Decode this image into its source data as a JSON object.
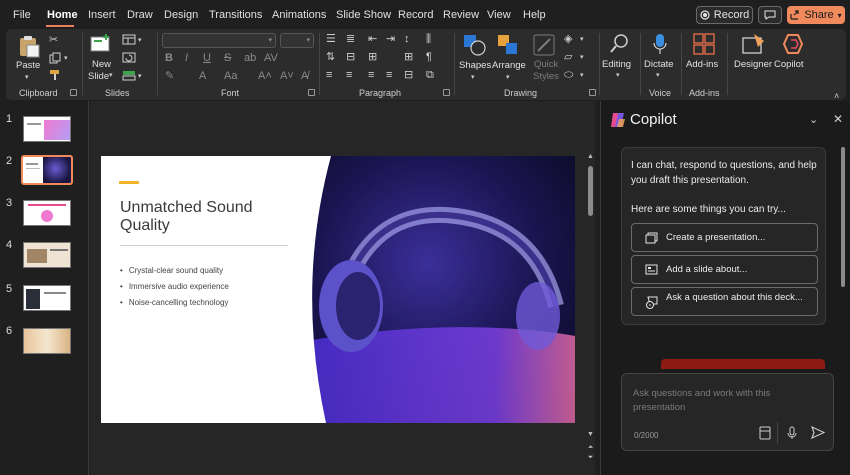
{
  "menu": {
    "items": [
      "File",
      "Home",
      "Insert",
      "Draw",
      "Design",
      "Transitions",
      "Animations",
      "Slide Show",
      "Record",
      "Review",
      "View",
      "Help"
    ],
    "active": "Home",
    "record_label": "Record",
    "share_label": "Share"
  },
  "ribbon": {
    "clipboard": {
      "paste": "Paste",
      "group": "Clipboard"
    },
    "slides": {
      "new_slide_line1": "New",
      "new_slide_line2": "Slide",
      "group": "Slides"
    },
    "font": {
      "group": "Font"
    },
    "paragraph": {
      "group": "Paragraph"
    },
    "drawing": {
      "shapes": "Shapes",
      "arrange": "Arrange",
      "quick_styles_line1": "Quick",
      "quick_styles_line2": "Styles",
      "group": "Drawing"
    },
    "editing": {
      "label": "Editing"
    },
    "voice": {
      "dictate": "Dictate",
      "group": "Voice"
    },
    "addins": {
      "label": "Add-ins",
      "group": "Add-ins"
    },
    "designer": {
      "label": "Designer"
    },
    "copilot": {
      "label": "Copilot"
    }
  },
  "thumbnails": [
    {
      "number": "1"
    },
    {
      "number": "2",
      "selected": true
    },
    {
      "number": "3"
    },
    {
      "number": "4"
    },
    {
      "number": "5"
    },
    {
      "number": "6"
    }
  ],
  "slide": {
    "title": "Unmatched Sound Quality",
    "bullets": [
      "Crystal-clear sound quality",
      "Immersive audio experience",
      "Noise-cancelling technology"
    ]
  },
  "copilot": {
    "title": "Copilot",
    "intro": "I can chat, respond to questions, and help you draft this presentation.",
    "suggest_intro": "Here are some things you can try...",
    "prompts": [
      "Create a presentation...",
      "Add a slide about...",
      "Ask a question about this deck..."
    ],
    "input_placeholder": "Ask questions and work with this presentation",
    "char_count": "0/2000"
  },
  "colors": {
    "accent": "#f08a5d",
    "slide_accent": "#f0b429",
    "copilot_strip": "#8c1c13"
  }
}
